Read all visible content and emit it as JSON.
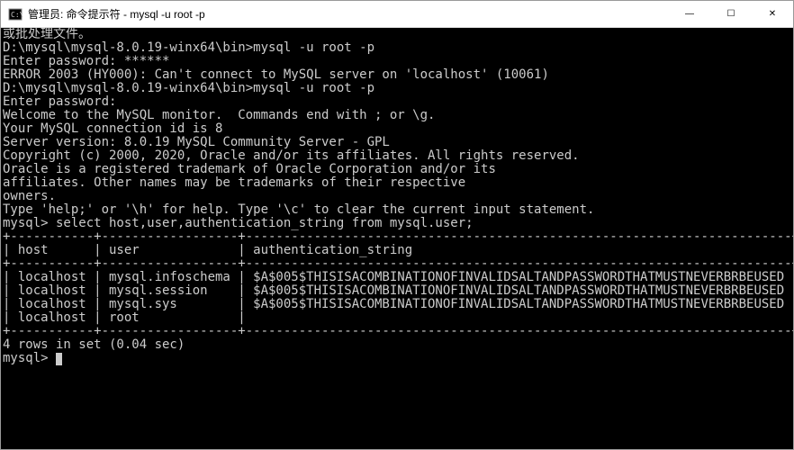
{
  "titlebar": {
    "icon": "cmd-icon",
    "title": "管理员: 命令提示符 - mysql  -u root -p"
  },
  "window_controls": {
    "minimize": "—",
    "maximize": "☐",
    "close": "✕"
  },
  "terminal": {
    "lines": [
      "或批处理文件。",
      "",
      "D:\\mysql\\mysql-8.0.19-winx64\\bin>mysql -u root -p",
      "Enter password: ******",
      "ERROR 2003 (HY000): Can't connect to MySQL server on 'localhost' (10061)",
      "",
      "D:\\mysql\\mysql-8.0.19-winx64\\bin>mysql -u root -p",
      "Enter password:",
      "Welcome to the MySQL monitor.  Commands end with ; or \\g.",
      "Your MySQL connection id is 8",
      "Server version: 8.0.19 MySQL Community Server - GPL",
      "",
      "Copyright (c) 2000, 2020, Oracle and/or its affiliates. All rights reserved.",
      "",
      "Oracle is a registered trademark of Oracle Corporation and/or its",
      "affiliates. Other names may be trademarks of their respective",
      "owners.",
      "",
      "Type 'help;' or '\\h' for help. Type '\\c' to clear the current input statement.",
      "",
      "mysql> select host,user,authentication_string from mysql.user;",
      "+-----------+------------------+------------------------------------------------------------------------+",
      "| host      | user             | authentication_string                                                  |",
      "+-----------+------------------+------------------------------------------------------------------------+",
      "| localhost | mysql.infoschema | $A$005$THISISACOMBINATIONOFINVALIDSALTANDPASSWORDTHATMUSTNEVERBRBEUSED |",
      "| localhost | mysql.session    | $A$005$THISISACOMBINATIONOFINVALIDSALTANDPASSWORDTHATMUSTNEVERBRBEUSED |",
      "| localhost | mysql.sys        | $A$005$THISISACOMBINATIONOFINVALIDSALTANDPASSWORDTHATMUSTNEVERBRBEUSED |",
      "| localhost | root             |                                                                        |",
      "+-----------+------------------+------------------------------------------------------------------------+",
      "4 rows in set (0.04 sec)",
      "",
      "mysql> "
    ],
    "prompt_cursor_line_index": 31
  },
  "table_data": {
    "columns": [
      "host",
      "user",
      "authentication_string"
    ],
    "rows": [
      {
        "host": "localhost",
        "user": "mysql.infoschema",
        "authentication_string": "$A$005$THISISACOMBINATIONOFINVALIDSALTANDPASSWORDTHATMUSTNEVERBRBEUSED"
      },
      {
        "host": "localhost",
        "user": "mysql.session",
        "authentication_string": "$A$005$THISISACOMBINATIONOFINVALIDSALTANDPASSWORDTHATMUSTNEVERBRBEUSED"
      },
      {
        "host": "localhost",
        "user": "mysql.sys",
        "authentication_string": "$A$005$THISISACOMBINATIONOFINVALIDSALTANDPASSWORDTHATMUSTNEVERBRBEUSED"
      },
      {
        "host": "localhost",
        "user": "root",
        "authentication_string": ""
      }
    ],
    "footer": "4 rows in set (0.04 sec)"
  }
}
